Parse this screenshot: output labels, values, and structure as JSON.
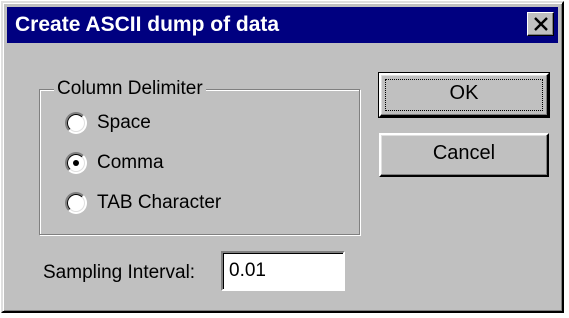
{
  "dialog": {
    "title": "Create ASCII dump of data",
    "close_glyph": "close-icon"
  },
  "column_delimiter": {
    "label": "Column Delimiter",
    "options": [
      {
        "label": "Space",
        "selected": false
      },
      {
        "label": "Comma",
        "selected": true
      },
      {
        "label": "TAB Character",
        "selected": false
      }
    ]
  },
  "sampling": {
    "label": "Sampling Interval:",
    "value": "0.01"
  },
  "buttons": {
    "ok_label": "OK",
    "cancel_label": "Cancel"
  },
  "colors": {
    "titlebar": "#000080",
    "face": "#c0c0c0"
  }
}
